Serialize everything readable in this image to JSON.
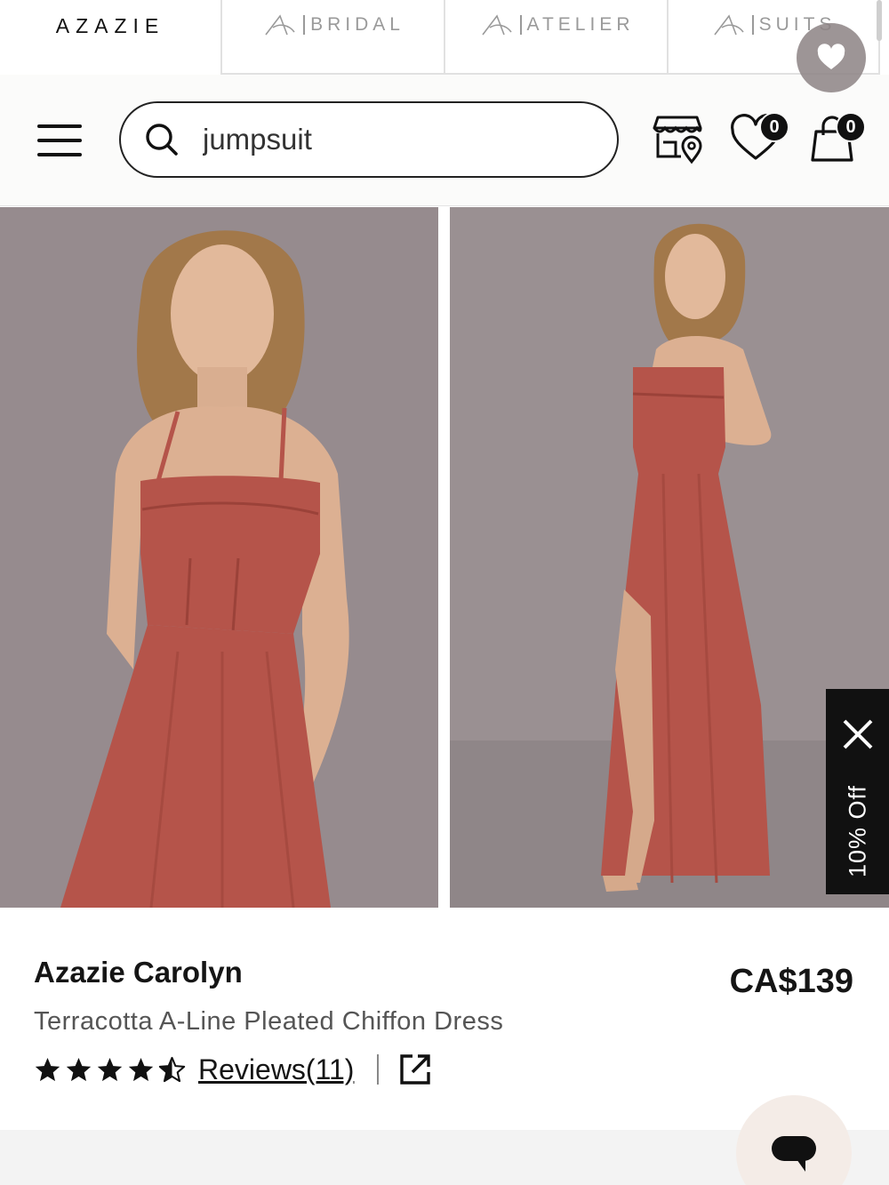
{
  "brand_tabs": {
    "main": "AZAZIE",
    "sub": [
      {
        "label": "BRIDAL",
        "icon": "azazie-a-logo-icon"
      },
      {
        "label": "ATELIER",
        "icon": "azazie-a-logo-icon"
      },
      {
        "label": "SUITS",
        "icon": "azazie-a-logo-icon"
      }
    ]
  },
  "header": {
    "search_value": "jumpsuit",
    "wishlist_count": "0",
    "bag_count": "0"
  },
  "discount_tab": {
    "label": "10% Off"
  },
  "product": {
    "name": "Azazie Carolyn",
    "description": "Terracotta A-Line Pleated Chiffon Dress",
    "price": "CA$139",
    "rating": 4.5,
    "reviews_label": "Reviews(11)"
  },
  "colors": {
    "dress": "#b5544a",
    "backdrop": "#9a9092",
    "badge": "#111111"
  }
}
